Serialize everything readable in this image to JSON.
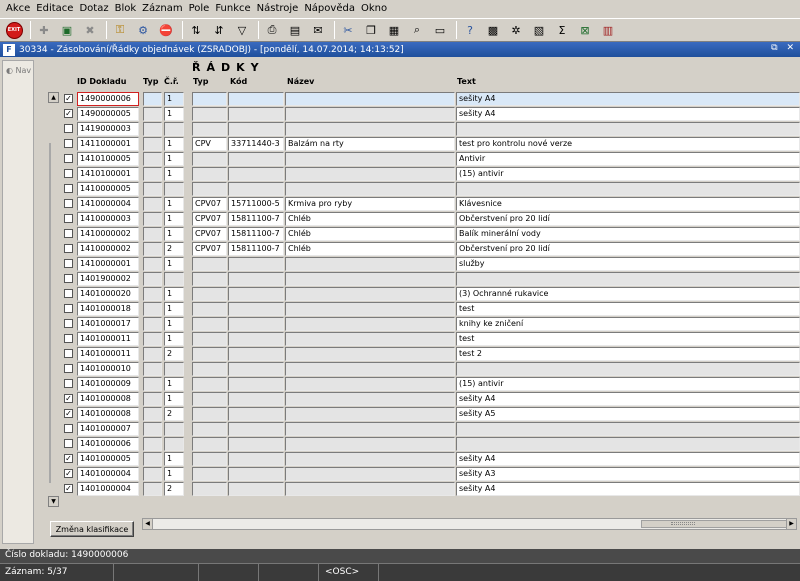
{
  "menu": [
    "Akce",
    "Editace",
    "Dotaz",
    "Blok",
    "Záznam",
    "Pole",
    "Funkce",
    "Nástroje",
    "Nápověda",
    "Okno"
  ],
  "toolbar": {
    "exit_label": "EXIT",
    "icons": [
      "save-icon",
      "print-icon",
      "enter-query-icon",
      "execute-query-icon",
      "filter-icon",
      "sort-icon",
      "report-icon",
      "mail-icon",
      "calendar-icon",
      "help-icon",
      "sum-icon",
      "excel-icon",
      "chart-icon"
    ]
  },
  "window": {
    "title": "30334 - Zásobování/Řádky objednávek (ZSRADOBJ) - [pondělí, 14.07.2014; 14:13:52]",
    "controls": "⧉ ✕"
  },
  "nav": {
    "label": "Nav"
  },
  "section_title": "ŘÁDKY",
  "columns": {
    "id": "ID Dokladu",
    "typ1": "Typ",
    "cr": "Č.ř.",
    "typ2": "Typ",
    "kod": "Kód",
    "nazev": "Název",
    "text": "Text"
  },
  "rows": [
    {
      "checked": true,
      "id": "1490000006",
      "cr": "1",
      "typ": "",
      "kod": "",
      "nazev": "",
      "text": "sešity A4"
    },
    {
      "checked": true,
      "id": "1490000005",
      "cr": "1",
      "typ": "",
      "kod": "",
      "nazev": "",
      "text": "sešity A4"
    },
    {
      "checked": false,
      "id": "1419000003",
      "cr": "",
      "typ": "",
      "kod": "",
      "nazev": "",
      "text": ""
    },
    {
      "checked": false,
      "id": "1411000001",
      "cr": "1",
      "typ": "CPV",
      "kod": "33711440-3",
      "nazev": "Balzám na rty",
      "text": "test pro kontrolu nové verze"
    },
    {
      "checked": false,
      "id": "1410100005",
      "cr": "1",
      "typ": "",
      "kod": "",
      "nazev": "",
      "text": "Antivir"
    },
    {
      "checked": false,
      "id": "1410100001",
      "cr": "1",
      "typ": "",
      "kod": "",
      "nazev": "",
      "text": "(15) antivir"
    },
    {
      "checked": false,
      "id": "1410000005",
      "cr": "",
      "typ": "",
      "kod": "",
      "nazev": "",
      "text": ""
    },
    {
      "checked": false,
      "id": "1410000004",
      "cr": "1",
      "typ": "CPV07",
      "kod": "15711000-5",
      "nazev": "Krmiva pro ryby",
      "text": "Klávesnice"
    },
    {
      "checked": false,
      "id": "1410000003",
      "cr": "1",
      "typ": "CPV07",
      "kod": "15811100-7",
      "nazev": "Chléb",
      "text": "Občerstvení pro 20 lidí"
    },
    {
      "checked": false,
      "id": "1410000002",
      "cr": "1",
      "typ": "CPV07",
      "kod": "15811100-7",
      "nazev": "Chléb",
      "text": "Balík minerální vody"
    },
    {
      "checked": false,
      "id": "1410000002",
      "cr": "2",
      "typ": "CPV07",
      "kod": "15811100-7",
      "nazev": "Chléb",
      "text": "Občerstvení pro 20 lidí"
    },
    {
      "checked": false,
      "id": "1410000001",
      "cr": "1",
      "typ": "",
      "kod": "",
      "nazev": "",
      "text": "služby"
    },
    {
      "checked": false,
      "id": "1401900002",
      "cr": "",
      "typ": "",
      "kod": "",
      "nazev": "",
      "text": ""
    },
    {
      "checked": false,
      "id": "1401000020",
      "cr": "1",
      "typ": "",
      "kod": "",
      "nazev": "",
      "text": "(3) Ochranné rukavice"
    },
    {
      "checked": false,
      "id": "1401000018",
      "cr": "1",
      "typ": "",
      "kod": "",
      "nazev": "",
      "text": "test"
    },
    {
      "checked": false,
      "id": "1401000017",
      "cr": "1",
      "typ": "",
      "kod": "",
      "nazev": "",
      "text": "knihy ke zničení"
    },
    {
      "checked": false,
      "id": "1401000011",
      "cr": "1",
      "typ": "",
      "kod": "",
      "nazev": "",
      "text": "test"
    },
    {
      "checked": false,
      "id": "1401000011",
      "cr": "2",
      "typ": "",
      "kod": "",
      "nazev": "",
      "text": "test 2"
    },
    {
      "checked": false,
      "id": "1401000010",
      "cr": "",
      "typ": "",
      "kod": "",
      "nazev": "",
      "text": ""
    },
    {
      "checked": false,
      "id": "1401000009",
      "cr": "1",
      "typ": "",
      "kod": "",
      "nazev": "",
      "text": "(15) antivir"
    },
    {
      "checked": true,
      "id": "1401000008",
      "cr": "1",
      "typ": "",
      "kod": "",
      "nazev": "",
      "text": "sešity A4"
    },
    {
      "checked": true,
      "id": "1401000008",
      "cr": "2",
      "typ": "",
      "kod": "",
      "nazev": "",
      "text": "sešity A5"
    },
    {
      "checked": false,
      "id": "1401000007",
      "cr": "",
      "typ": "",
      "kod": "",
      "nazev": "",
      "text": ""
    },
    {
      "checked": false,
      "id": "1401000006",
      "cr": "",
      "typ": "",
      "kod": "",
      "nazev": "",
      "text": ""
    },
    {
      "checked": true,
      "id": "1401000005",
      "cr": "1",
      "typ": "",
      "kod": "",
      "nazev": "",
      "text": "sešity A4"
    },
    {
      "checked": true,
      "id": "1401000004",
      "cr": "1",
      "typ": "",
      "kod": "",
      "nazev": "",
      "text": "sešity A3"
    },
    {
      "checked": true,
      "id": "1401000004",
      "cr": "2",
      "typ": "",
      "kod": "",
      "nazev": "",
      "text": "sešity A4"
    }
  ],
  "button_klasifikace": "Změna klasifikace",
  "status": {
    "doc": "Číslo dokladu: 1490000006",
    "record": "Záznam: 5/37",
    "mode": "<OSC>"
  }
}
